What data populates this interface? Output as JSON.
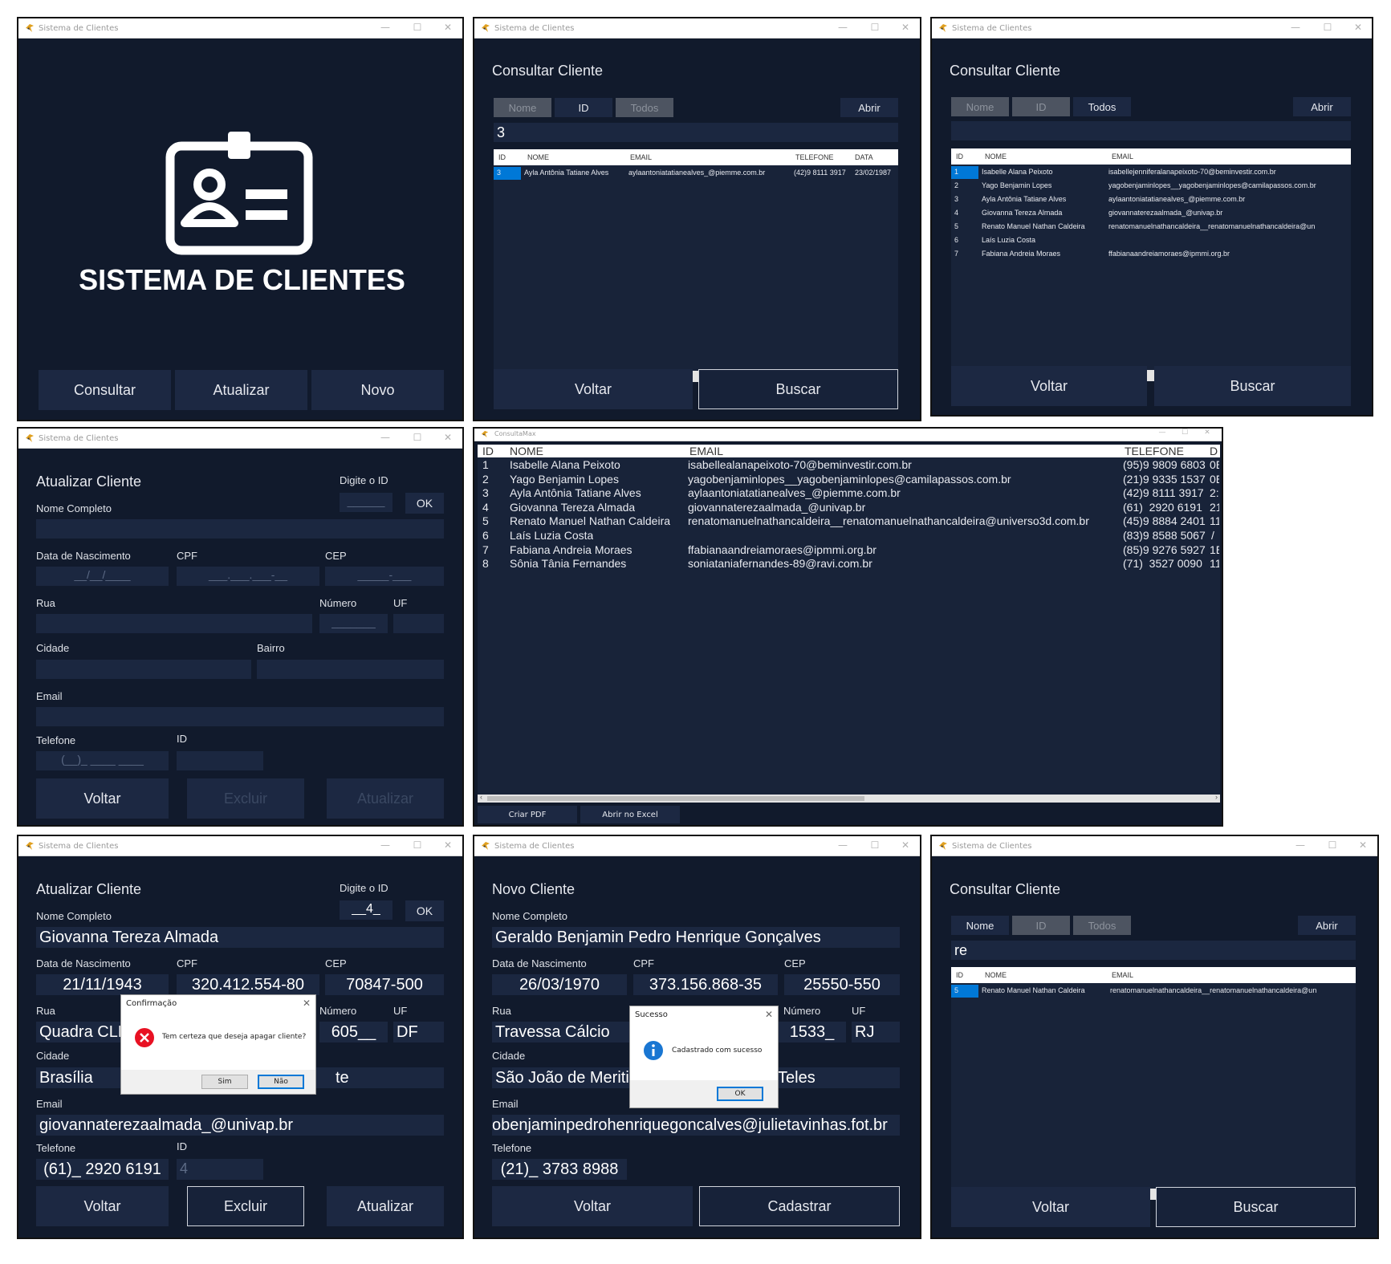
{
  "app_title": "Sistema de Clientes",
  "excel_title": "ConsultaMax",
  "win_ctrls": {
    "min": "—",
    "max": "☐",
    "close": "✕"
  },
  "home": {
    "title": "SISTEMA DE CLIENTES",
    "buttons": [
      "Consultar",
      "Atualizar",
      "Novo"
    ]
  },
  "consult": {
    "heading": "Consultar Cliente",
    "tabs": [
      "Nome",
      "ID",
      "Todos"
    ],
    "open": "Abrir",
    "back": "Voltar",
    "search": "Buscar",
    "cols5": [
      "ID",
      "NOME",
      "EMAIL",
      "TELEFONE",
      "DATA"
    ],
    "cols3": [
      "ID",
      "NOME",
      "EMAIL"
    ]
  },
  "consult1": {
    "query": "3",
    "rows": [
      {
        "id": "3",
        "nome": "Ayla Antônia Tatiane Alves",
        "email": "aylaantoniatatianealves_@piemme.com.br",
        "tel": "(42)9 8111 3917",
        "data": "23/02/1987"
      }
    ]
  },
  "consult2": {
    "rows": [
      {
        "id": "1",
        "nome": "Isabelle Alana Peixoto",
        "email": "isabellejenniferalanapeixoto-70@beminvestir.com.br"
      },
      {
        "id": "2",
        "nome": "Yago Benjamin Lopes",
        "email": "yagobenjaminlopes__yagobenjaminlopes@camilapassos.com.br"
      },
      {
        "id": "3",
        "nome": "Ayla Antônia Tatiane Alves",
        "email": "aylaantoniatatianealves_@piemme.com.br"
      },
      {
        "id": "4",
        "nome": "Giovanna Tereza Almada",
        "email": "giovannaterezaalmada_@univap.br"
      },
      {
        "id": "5",
        "nome": "Renato Manuel Nathan Caldeira",
        "email": "renatomanuelnathancaldeira__renatomanuelnathancaldeira@un"
      },
      {
        "id": "6",
        "nome": "Laís Luzia Costa",
        "email": ""
      },
      {
        "id": "7",
        "nome": "Fabiana Andreia Moraes",
        "email": "ffabianaandreiamoraes@ipmmi.org.br"
      }
    ]
  },
  "consult3": {
    "query": "re",
    "rows": [
      {
        "id": "5",
        "nome": "Renato Manuel Nathan Caldeira",
        "email": "renatomanuelnathancaldeira__renatomanuelnathancaldeira@un"
      }
    ]
  },
  "update": {
    "heading": "Atualizar Cliente",
    "digite": "Digite o ID",
    "ok": "OK",
    "labels": {
      "nome": "Nome Completo",
      "nasc": "Data de Nascimento",
      "cpf": "CPF",
      "cep": "CEP",
      "rua": "Rua",
      "num": "Número",
      "uf": "UF",
      "cidade": "Cidade",
      "bairro": "Bairro",
      "email": "Email",
      "tel": "Telefone",
      "id": "ID"
    },
    "buttons": {
      "back": "Voltar",
      "del": "Excluir",
      "upd": "Atualizar"
    },
    "empty": {
      "id_input": "______",
      "nasc": "__/__/____",
      "cpf": "___.___.___-__",
      "cep": "_____-___",
      "num": "_______",
      "tel": "(__)_ ____ ____"
    }
  },
  "update2": {
    "id_input": "__4_",
    "nome": "Giovanna Tereza Almada",
    "nasc": "21/11/1943",
    "cpf": "320.412.554-80",
    "cep": "70847-500",
    "rua": "Quadra CLN",
    "num": "605__",
    "uf": "DF",
    "cidade": "Brasília",
    "bairro_tail": "te",
    "email": "giovannaterezaalmada_@univap.br",
    "tel": "(61)_ 2920 6191",
    "id": "4",
    "dialog": {
      "title": "Confirmação",
      "msg": "Tem certeza que deseja apagar cliente?",
      "yes": "Sim",
      "no": "Não"
    }
  },
  "novo": {
    "heading": "Novo Cliente",
    "nome": "Geraldo Benjamin Pedro Henrique Gonçalves",
    "nasc": "26/03/1970",
    "cpf": "373.156.868-35",
    "cep": "25550-550",
    "rua": "Travessa Cálcio",
    "num": "1533_",
    "uf": "RJ",
    "cidade": "São João de Meriti",
    "bairro": "Teles",
    "email": "obenjaminpedrohenriquegoncalves@julietavinhas.fot.br",
    "tel": "(21)_ 3783 8988",
    "back": "Voltar",
    "save": "Cadastrar",
    "dialog": {
      "title": "Sucesso",
      "msg": "Cadastrado com sucesso",
      "ok": "OK"
    }
  },
  "excel": {
    "cols": [
      "ID",
      "NOME",
      "EMAIL",
      "TELEFONE",
      "D"
    ],
    "rows": [
      {
        "id": "1",
        "nome": "Isabelle Alana Peixoto",
        "email": "isabellealanapeixoto-70@beminvestir.com.br",
        "tel": "(95)9 9809 6803",
        "d": "0E"
      },
      {
        "id": "2",
        "nome": "Yago Benjamin Lopes",
        "email": "yagobenjaminlopes__yagobenjaminlopes@camilapassos.com.br",
        "tel": "(21)9 9335 1537",
        "d": "0E"
      },
      {
        "id": "3",
        "nome": "Ayla Antônia Tatiane Alves",
        "email": "aylaantoniatatianealves_@piemme.com.br",
        "tel": "(42)9 8111 3917",
        "d": "2:"
      },
      {
        "id": "4",
        "nome": "Giovanna Tereza Almada",
        "email": "giovannaterezaalmada_@univap.br",
        "tel": "(61)  2920 6191",
        "d": "21"
      },
      {
        "id": "5",
        "nome": "Renato Manuel Nathan Caldeira",
        "email": "renatomanuelnathancaldeira__renatomanuelnathancaldeira@universo3d.com.br",
        "tel": "(45)9 8884 2401",
        "d": "11"
      },
      {
        "id": "6",
        "nome": "Laís Luzia Costa",
        "email": "",
        "tel": "(83)9 8588 5067",
        "d": "/"
      },
      {
        "id": "7",
        "nome": "Fabiana Andreia Moraes",
        "email": "ffabianaandreiamoraes@ipmmi.org.br",
        "tel": "(85)9 9276 5927",
        "d": "1E"
      },
      {
        "id": "8",
        "nome": "Sônia Tânia Fernandes",
        "email": "soniataniafernandes-89@ravi.com.br",
        "tel": "(71)  3527 0090",
        "d": "11"
      }
    ],
    "pdf": "Criar PDF",
    "xls": "Abrir no Excel"
  },
  "colors": {
    "bg": "#111a2c",
    "field": "#1b2740",
    "button": "#1c2842",
    "selected": "#0078d7"
  }
}
